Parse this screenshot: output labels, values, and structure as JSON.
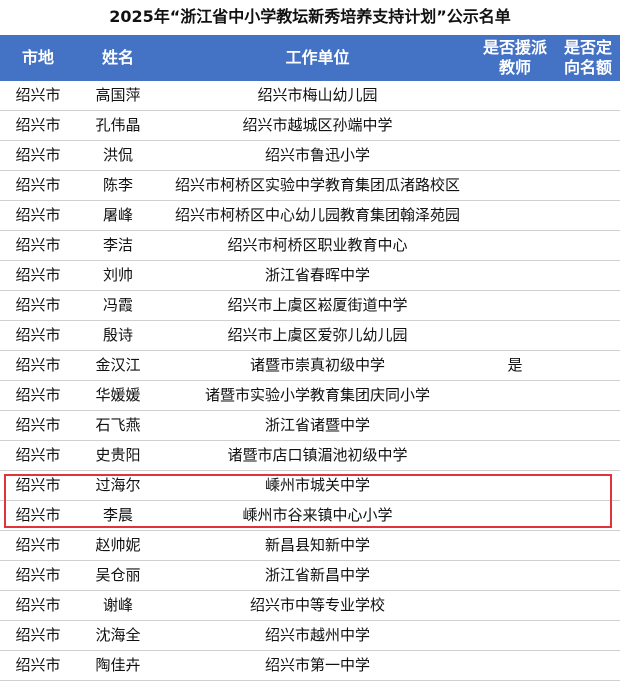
{
  "title": "2025年“浙江省中小学教坛新秀培养支持计划”公示名单",
  "headers": [
    "市地",
    "姓名",
    "工作单位",
    "是否援派教师",
    "是否定向名额"
  ],
  "rows": [
    {
      "city": "绍兴市",
      "name": "高国萍",
      "unit": "绍兴市梅山幼儿园",
      "aid": "",
      "targeted": ""
    },
    {
      "city": "绍兴市",
      "name": "孔伟晶",
      "unit": "绍兴市越城区孙端中学",
      "aid": "",
      "targeted": ""
    },
    {
      "city": "绍兴市",
      "name": "洪侃",
      "unit": "绍兴市鲁迅小学",
      "aid": "",
      "targeted": ""
    },
    {
      "city": "绍兴市",
      "name": "陈李",
      "unit": "绍兴市柯桥区实验中学教育集团瓜渚路校区",
      "aid": "",
      "targeted": ""
    },
    {
      "city": "绍兴市",
      "name": "屠峰",
      "unit": "绍兴市柯桥区中心幼儿园教育集团翰泽苑园",
      "aid": "",
      "targeted": ""
    },
    {
      "city": "绍兴市",
      "name": "李洁",
      "unit": "绍兴市柯桥区职业教育中心",
      "aid": "",
      "targeted": ""
    },
    {
      "city": "绍兴市",
      "name": "刘帅",
      "unit": "浙江省春晖中学",
      "aid": "",
      "targeted": ""
    },
    {
      "city": "绍兴市",
      "name": "冯霞",
      "unit": "绍兴市上虞区崧厦街道中学",
      "aid": "",
      "targeted": ""
    },
    {
      "city": "绍兴市",
      "name": "殷诗",
      "unit": "绍兴市上虞区爱弥儿幼儿园",
      "aid": "",
      "targeted": ""
    },
    {
      "city": "绍兴市",
      "name": "金汉江",
      "unit": "诸暨市崇真初级中学",
      "aid": "是",
      "targeted": ""
    },
    {
      "city": "绍兴市",
      "name": "华媛媛",
      "unit": "诸暨市实验小学教育集团庆同小学",
      "aid": "",
      "targeted": ""
    },
    {
      "city": "绍兴市",
      "name": "石飞燕",
      "unit": "浙江省诸暨中学",
      "aid": "",
      "targeted": ""
    },
    {
      "city": "绍兴市",
      "name": "史贵阳",
      "unit": "诸暨市店口镇湄池初级中学",
      "aid": "",
      "targeted": ""
    },
    {
      "city": "绍兴市",
      "name": "过海尔",
      "unit": "嵊州市城关中学",
      "aid": "",
      "targeted": ""
    },
    {
      "city": "绍兴市",
      "name": "李晨",
      "unit": "嵊州市谷来镇中心小学",
      "aid": "",
      "targeted": ""
    },
    {
      "city": "绍兴市",
      "name": "赵帅妮",
      "unit": "新昌县知新中学",
      "aid": "",
      "targeted": ""
    },
    {
      "city": "绍兴市",
      "name": "吴仓丽",
      "unit": "浙江省新昌中学",
      "aid": "",
      "targeted": ""
    },
    {
      "city": "绍兴市",
      "name": "谢峰",
      "unit": "绍兴市中等专业学校",
      "aid": "",
      "targeted": ""
    },
    {
      "city": "绍兴市",
      "name": "沈海全",
      "unit": "绍兴市越州中学",
      "aid": "",
      "targeted": ""
    },
    {
      "city": "绍兴市",
      "name": "陶佳卉",
      "unit": "绍兴市第一中学",
      "aid": "",
      "targeted": ""
    }
  ],
  "colors": {
    "header_bg": "#4472c4",
    "highlight_border": "#e0343a"
  }
}
